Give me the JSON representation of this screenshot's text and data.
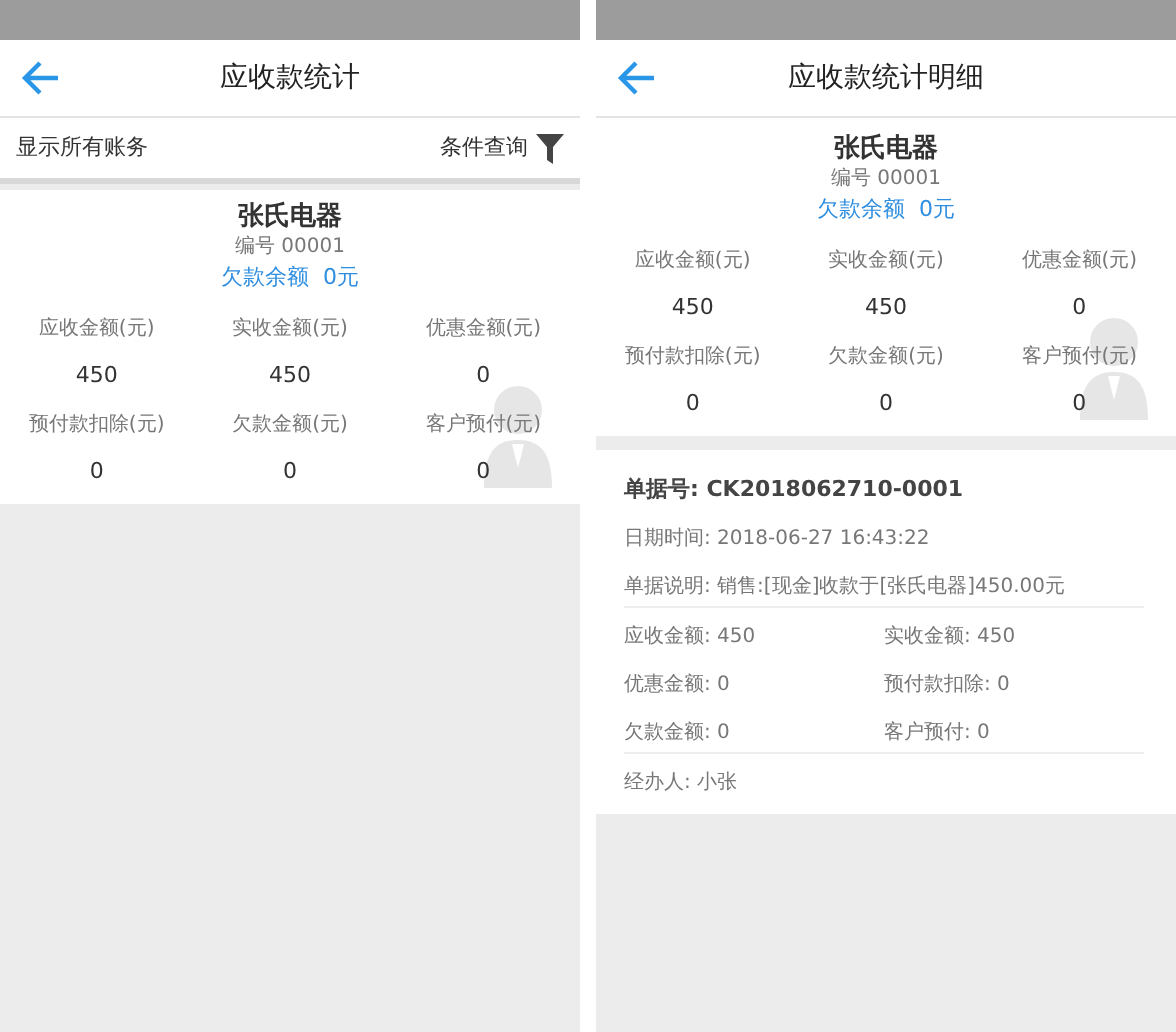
{
  "screens": [
    {
      "title": "应收款统计",
      "filter_bar": {
        "label": "显示所有账务",
        "action": "条件查询"
      },
      "summary": {
        "name": "张氏电器",
        "code": "编号 00001",
        "balance": "欠款余额  0元",
        "stats": [
          {
            "label": "应收金额(元)",
            "value": "450"
          },
          {
            "label": "实收金额(元)",
            "value": "450"
          },
          {
            "label": "优惠金额(元)",
            "value": "0"
          },
          {
            "label": "预付款扣除(元)",
            "value": "0"
          },
          {
            "label": "欠款金额(元)",
            "value": "0"
          },
          {
            "label": "客户预付(元)",
            "value": "0"
          }
        ]
      }
    },
    {
      "title": "应收款统计明细",
      "summary": {
        "name": "张氏电器",
        "code": "编号 00001",
        "balance": "欠款余额  0元",
        "stats": [
          {
            "label": "应收金额(元)",
            "value": "450"
          },
          {
            "label": "实收金额(元)",
            "value": "450"
          },
          {
            "label": "优惠金额(元)",
            "value": "0"
          },
          {
            "label": "预付款扣除(元)",
            "value": "0"
          },
          {
            "label": "欠款金额(元)",
            "value": "0"
          },
          {
            "label": "客户预付(元)",
            "value": "0"
          }
        ]
      },
      "record": {
        "number": "单据号: CK2018062710-0001",
        "datetime": "日期时间: 2018-06-27 16:43:22",
        "description": "单据说明: 销售:[现金]收款于[张氏电器]450.00元",
        "fields": [
          {
            "label": "应收金额:",
            "value": "450"
          },
          {
            "label": "实收金额:",
            "value": "450"
          },
          {
            "label": "优惠金额:",
            "value": "0"
          },
          {
            "label": "预付款扣除:",
            "value": "0"
          },
          {
            "label": "欠款金额:",
            "value": "0"
          },
          {
            "label": "客户预付:",
            "value": "0"
          }
        ],
        "handler": "经办人: 小张"
      }
    }
  ]
}
